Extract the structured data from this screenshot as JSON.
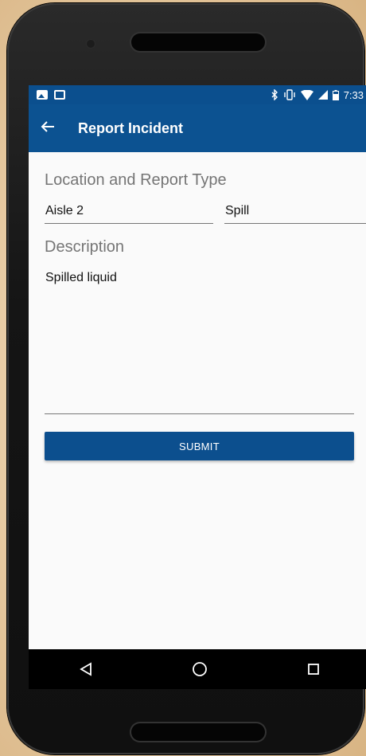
{
  "status_bar": {
    "time": "7:33",
    "left_icons": [
      "image-icon",
      "clipboard-check-icon"
    ],
    "right_icons": [
      "bluetooth-icon",
      "vibrate-icon",
      "wifi-icon",
      "signal-icon",
      "battery-icon"
    ]
  },
  "app_bar": {
    "title": "Report Incident",
    "back_icon": "arrow-left-icon"
  },
  "form": {
    "location_type_label": "Location and Report Type",
    "location_value": "Aisle 2",
    "type_value": "Spill",
    "description_label": "Description",
    "description_value": "Spilled liquid",
    "submit_label": "SUBMIT"
  },
  "nav_bar": {
    "buttons": [
      "back-triangle-icon",
      "home-circle-icon",
      "recents-square-icon"
    ]
  },
  "colors": {
    "primary": "#0c5291",
    "status_bar": "#0b4f8e",
    "button": "#0c4f8e",
    "background": "#fafafa",
    "label_gray": "#757575"
  }
}
